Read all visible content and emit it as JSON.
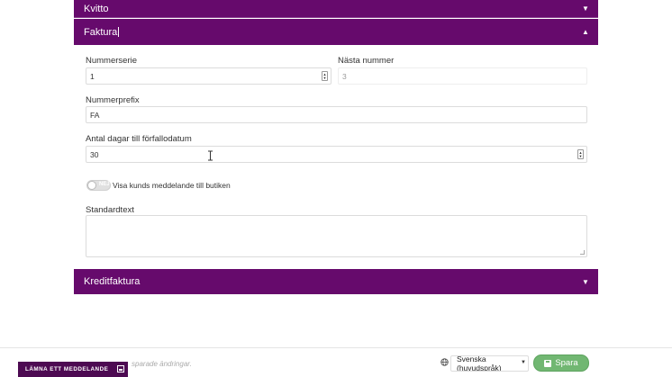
{
  "sections": {
    "kvitto": {
      "title": "Kvitto",
      "expanded": false
    },
    "faktura": {
      "title": "Faktura",
      "expanded": true
    },
    "kreditfaktura": {
      "title": "Kreditfaktura",
      "expanded": false
    }
  },
  "faktura_form": {
    "nummerserie_label": "Nummerserie",
    "nummerserie_value": "1",
    "nasta_nummer_label": "Nästa nummer",
    "nasta_nummer_value": "3",
    "nummerprefix_label": "Nummerprefix",
    "nummerprefix_value": "FA",
    "antal_dagar_label": "Antal dagar till förfallodatum",
    "antal_dagar_value": "30",
    "toggle_state_text": "NEJ",
    "toggle_label": "Visa kunds meddelande till butiken",
    "standardtext_label": "Standardtext",
    "standardtext_value": ""
  },
  "footer": {
    "unsaved_text": "sparade ändringar.",
    "language_selected": "Svenska (huvudspråk)",
    "save_label": "Spara"
  },
  "leave_message": {
    "label": "LÄMNA ETT MEDDELANDE"
  },
  "colors": {
    "header_purple": "#660a6c",
    "leave_message_bg": "#4d0a52",
    "save_green": "#71b772"
  },
  "icons": [
    "caret-down-icon",
    "caret-up-icon",
    "spinner-icon",
    "globe-icon",
    "save-disk-icon",
    "minimize-icon",
    "text-cursor-icon",
    "resize-grip-icon"
  ]
}
